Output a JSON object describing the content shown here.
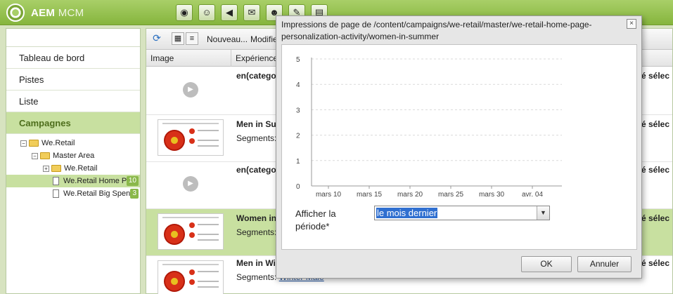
{
  "header": {
    "app_name": "AEM",
    "app_module": "MCM",
    "tools": [
      "globe-icon",
      "people-icon",
      "campaign-icon",
      "mail-icon",
      "users-icon",
      "tools-icon",
      "document-icon"
    ]
  },
  "sidebar": {
    "items": [
      {
        "label": "Tableau de bord",
        "active": false
      },
      {
        "label": "Pistes",
        "active": false
      },
      {
        "label": "Liste",
        "active": false
      },
      {
        "label": "Campagnes",
        "active": true
      }
    ],
    "tree": [
      {
        "label": "We.Retail",
        "toggle": "−",
        "type": "folder",
        "level": 0
      },
      {
        "label": "Master Area",
        "toggle": "−",
        "type": "folder",
        "level": 1
      },
      {
        "label": "We.Retail",
        "toggle": "+",
        "type": "folder",
        "level": 2
      },
      {
        "label": "We.Retail Home Pa",
        "type": "page",
        "level": 2,
        "badge": "10",
        "selected": true
      },
      {
        "label": "We.Retail Big Spen",
        "type": "page",
        "level": 2,
        "badge": "3",
        "selected": false
      }
    ]
  },
  "grid": {
    "toolbar": {
      "new_label": "Nouveau...",
      "edit_label": "Modifier"
    },
    "columns": {
      "image": "Image",
      "experience": "Expérience"
    },
    "rows": [
      {
        "title": "en(catego",
        "segments_label": "",
        "segment": "",
        "right": "té sélec",
        "thumb": false,
        "selected": false
      },
      {
        "title": "Men in Sur",
        "segments_label": "Segments:",
        "segment": "S",
        "right": "té sélec",
        "thumb": true,
        "selected": false
      },
      {
        "title": "en(catego",
        "segments_label": "",
        "segment": "",
        "right": "té sélec",
        "thumb": false,
        "selected": false
      },
      {
        "title": "Women in",
        "segments_label": "Segments:",
        "segment": "S",
        "right": "té sélec",
        "thumb": true,
        "selected": true
      },
      {
        "title": "Men in Win",
        "segments_label": "Segments:",
        "segment": "Winter Male",
        "right": "té sélec",
        "thumb": true,
        "selected": false
      }
    ]
  },
  "dialog": {
    "title": "Impressions de page de /content/campaigns/we-retail/master/we-retail-home-page-personalization-activity/women-in-summer",
    "close": "×",
    "period_label": "Afficher la période*",
    "period_value": "le mois dernier",
    "ok": "OK",
    "cancel": "Annuler"
  },
  "chart_data": {
    "type": "line",
    "title": "",
    "xlabel": "",
    "ylabel": "",
    "y_ticks": [
      "0",
      "1",
      "2",
      "3",
      "4",
      "5"
    ],
    "ylim": [
      0,
      5
    ],
    "x_ticks": [
      "mars 10",
      "mars 15",
      "mars 20",
      "mars 25",
      "mars 30",
      "avr. 04"
    ],
    "series": [],
    "grid": true
  }
}
